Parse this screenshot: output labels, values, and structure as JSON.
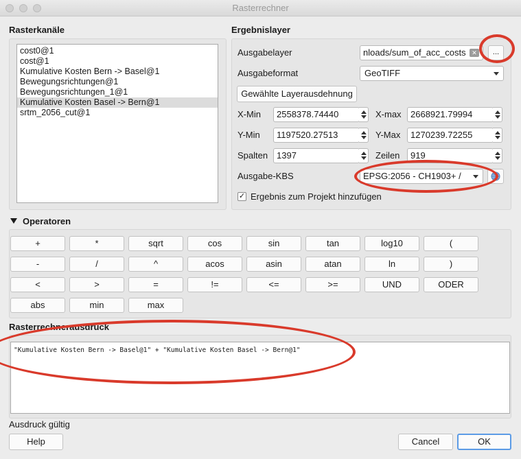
{
  "window": {
    "title": "Rasterrechner"
  },
  "raster_bands": {
    "title": "Rasterkanäle",
    "items": [
      {
        "label": "cost0@1",
        "selected": false
      },
      {
        "label": "cost@1",
        "selected": false
      },
      {
        "label": "Kumulative Kosten Bern -> Basel@1",
        "selected": false
      },
      {
        "label": "Bewegungsrichtungen@1",
        "selected": false
      },
      {
        "label": "Bewegungsrichtungen_1@1",
        "selected": false
      },
      {
        "label": "Kumulative Kosten Basel -> Bern@1",
        "selected": true
      },
      {
        "label": "srtm_2056_cut@1",
        "selected": false
      }
    ]
  },
  "result_layer": {
    "title": "Ergebnislayer",
    "output_layer_label": "Ausgabelayer",
    "output_layer_value": "nloads/sum_of_acc_costs",
    "browse_label": "...",
    "format_label": "Ausgabeformat",
    "format_value": "GeoTIFF",
    "extent_button": "Gewählte Layerausdehnung",
    "xmin_label": "X-Min",
    "xmin_value": "2558378.74440",
    "xmax_label": "X-max",
    "xmax_value": "2668921.79994",
    "ymin_label": "Y-Min",
    "ymin_value": "1197520.27513",
    "ymax_label": "Y-Max",
    "ymax_value": "1270239.72255",
    "cols_label": "Spalten",
    "cols_value": "1397",
    "rows_label": "Zeilen",
    "rows_value": "919",
    "crs_label": "Ausgabe-KBS",
    "crs_value": "EPSG:2056 - CH1903+ /",
    "add_to_project_label": "Ergebnis zum Projekt hinzufügen",
    "add_to_project_checked": true
  },
  "operators": {
    "title": "Operatoren",
    "rows": [
      [
        "+",
        "*",
        "sqrt",
        "cos",
        "sin",
        "tan",
        "log10",
        "("
      ],
      [
        "-",
        "/",
        "^",
        "acos",
        "asin",
        "atan",
        "ln",
        ")"
      ],
      [
        "<",
        ">",
        "=",
        "!=",
        "<=",
        ">=",
        "UND",
        "ODER"
      ],
      [
        "abs",
        "min",
        "max"
      ]
    ]
  },
  "expression": {
    "title": "Rasterrechnerausdruck",
    "value": "\"Kumulative Kosten Bern -> Basel@1\" + \"Kumulative Kosten Basel -> Bern@1\""
  },
  "footer": {
    "status": "Ausdruck gültig",
    "help": "Help",
    "cancel": "Cancel",
    "ok": "OK"
  },
  "colors": {
    "annotation_red": "#d93a2b",
    "ok_border": "#5b9be6"
  }
}
